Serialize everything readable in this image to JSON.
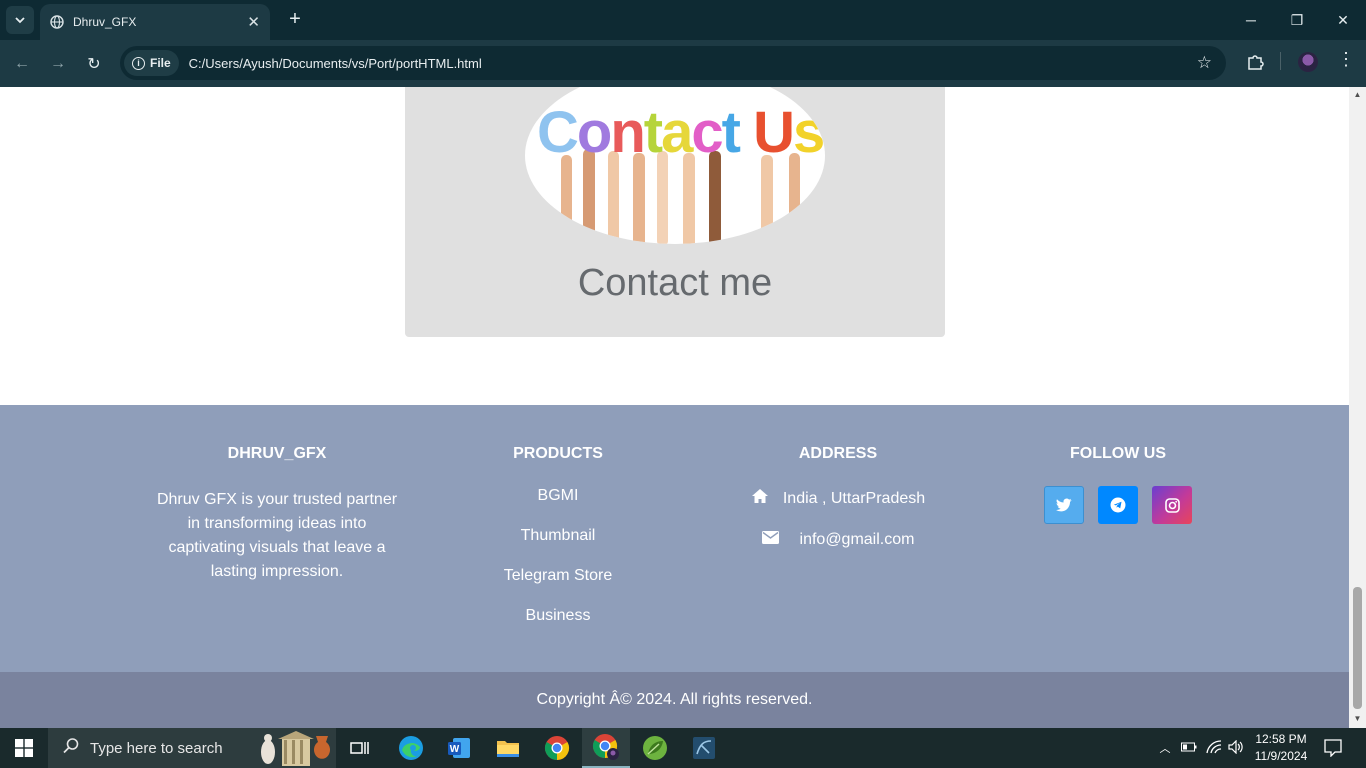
{
  "browser": {
    "tab_title": "Dhruv_GFX",
    "url_chip": "File",
    "url": "C:/Users/Ayush/Documents/vs/Port/portHTML.html"
  },
  "contact": {
    "image_text": "Contact Us",
    "title": "Contact me"
  },
  "footer": {
    "brand": {
      "heading": "DHRUV_GFX",
      "description": "Dhruv GFX is your trusted partner in transforming ideas into captivating visuals that leave a lasting impression."
    },
    "products": {
      "heading": "PRODUCTS",
      "items": [
        "BGMI",
        "Thumbnail",
        "Telegram Store",
        "Business"
      ]
    },
    "address": {
      "heading": "ADDRESS",
      "location": "India , UttarPradesh",
      "email": "info@gmail.com"
    },
    "follow": {
      "heading": "FOLLOW US",
      "twitter_color": "#55acee",
      "telegram_color": "#0088ff",
      "instagram_color": "#b13fb0"
    },
    "copyright": "Copyright Â© 2024. All rights reserved."
  },
  "taskbar": {
    "search_placeholder": "Type here to search",
    "time": "12:58 PM",
    "date": "11/9/2024"
  }
}
